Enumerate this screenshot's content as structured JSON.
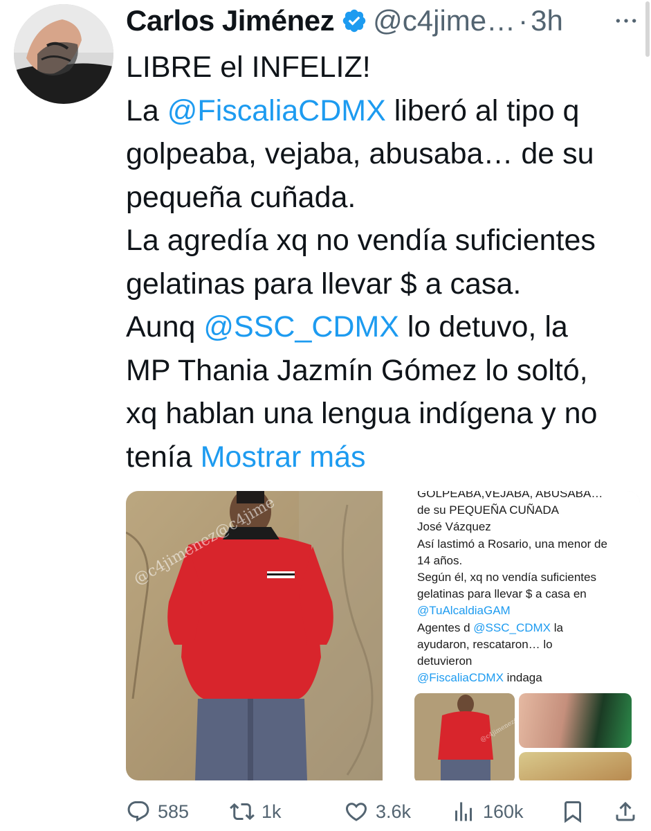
{
  "author": {
    "name": "Carlos Jiménez",
    "handle": "@c4jime…",
    "separator": "·",
    "time": "3h"
  },
  "tweet": {
    "lines": [
      [
        {
          "t": "LIBRE el INFELIZ!",
          "k": "text"
        }
      ],
      [
        {
          "t": "La ",
          "k": "text"
        },
        {
          "t": "@FiscaliaCDMX",
          "k": "mention"
        },
        {
          "t": " liberó al tipo q",
          "k": "text"
        }
      ],
      [
        {
          "t": "golpeaba, vejaba, abusaba… de su",
          "k": "text"
        }
      ],
      [
        {
          "t": "pequeña cuñada.",
          "k": "text"
        }
      ],
      [
        {
          "t": "La agredía xq no vendía suficientes",
          "k": "text"
        }
      ],
      [
        {
          "t": "gelatinas para llevar $ a casa.",
          "k": "text"
        }
      ],
      [
        {
          "t": "Aunq ",
          "k": "text"
        },
        {
          "t": "@SSC_CDMX",
          "k": "mention"
        },
        {
          "t": " lo detuvo, la",
          "k": "text"
        }
      ],
      [
        {
          "t": "MP Thania Jazmín Gómez lo soltó,",
          "k": "text"
        }
      ],
      [
        {
          "t": "xq hablan una lengua indígena y no",
          "k": "text"
        }
      ],
      [
        {
          "t": "tenía ",
          "k": "text"
        },
        {
          "t": "Mostrar más",
          "k": "showmore"
        }
      ]
    ]
  },
  "media": {
    "watermark": "@c4jimenez@c4jime",
    "thumb_watermark": "@c4jimenez@c4jime",
    "screenshot_lines": [
      {
        "t": "GOLPEABA,VEJABA, ABUSABA…",
        "k": "text"
      },
      {
        "t": "de su PEQUEÑA CUÑADA",
        "k": "text"
      },
      {
        "t": "José Vázquez",
        "k": "text"
      },
      {
        "t": "Así lastimó a Rosario, una menor de",
        "k": "text"
      },
      {
        "t": "14 años.",
        "k": "text"
      },
      {
        "t": "Según él, xq no vendía suficientes",
        "k": "text"
      },
      {
        "t": "gelatinas para llevar $ a casa en",
        "k": "text"
      },
      {
        "t": "@TuAlcaldiaGAM",
        "k": "mention"
      },
      {
        "t": "Agentes d ",
        "k": "text",
        "m": "@SSC_CDMX",
        "after": " la"
      },
      {
        "t": "ayudaron, rescataron… lo",
        "k": "text"
      },
      {
        "t": "detuvieron",
        "k": "text"
      },
      {
        "t": "@FiscaliaCDMX",
        "k": "mention",
        "after": " indaga"
      }
    ]
  },
  "actions": {
    "replies": "585",
    "reposts": "1k",
    "likes": "3.6k",
    "views": "160k"
  },
  "colors": {
    "accent": "#1d9bf0",
    "secondary": "#536471",
    "text": "#0f1419"
  },
  "icons": [
    "verified-badge-icon",
    "more-icon",
    "reply-icon",
    "repost-icon",
    "like-icon",
    "views-icon",
    "bookmark-icon",
    "share-icon"
  ]
}
